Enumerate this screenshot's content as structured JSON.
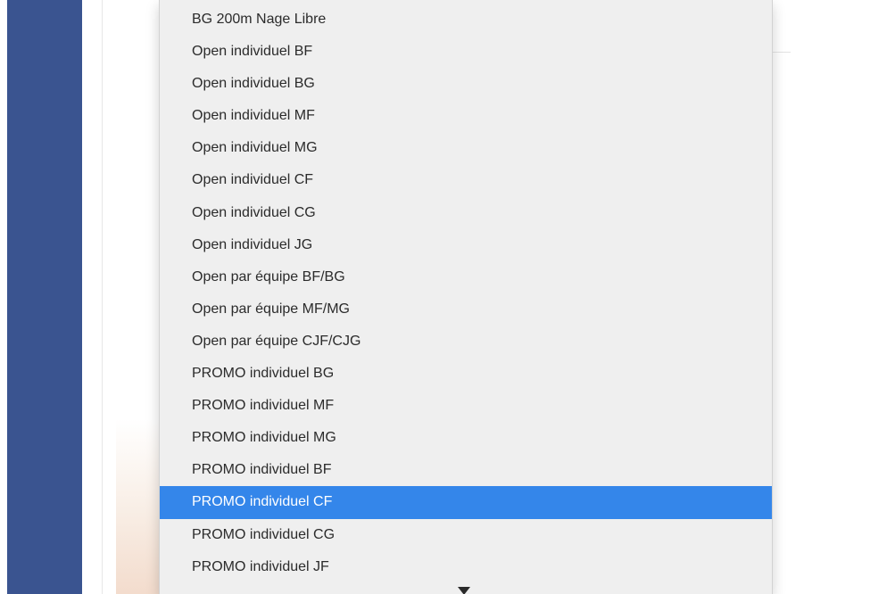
{
  "dropdown": {
    "selected_index": 15,
    "items": [
      {
        "label": "BG 200m Nage Libre"
      },
      {
        "label": "Open individuel BF"
      },
      {
        "label": "Open individuel BG"
      },
      {
        "label": "Open individuel MF"
      },
      {
        "label": "Open individuel MG"
      },
      {
        "label": "Open individuel CF"
      },
      {
        "label": "Open individuel CG"
      },
      {
        "label": "Open individuel JG"
      },
      {
        "label": "Open par équipe BF/BG"
      },
      {
        "label": "Open par équipe MF/MG"
      },
      {
        "label": "Open par équipe CJF/CJG"
      },
      {
        "label": "PROMO individuel BG"
      },
      {
        "label": "PROMO individuel MF"
      },
      {
        "label": "PROMO individuel MG"
      },
      {
        "label": "PROMO individuel BF"
      },
      {
        "label": "PROMO individuel CF"
      },
      {
        "label": "PROMO individuel CG"
      },
      {
        "label": "PROMO individuel JF"
      }
    ],
    "scroll_indicator_icon": "triangle-down-icon"
  },
  "colors": {
    "sidebar": "#3a5490",
    "selection": "#3486ea",
    "menu_background": "#efefef"
  }
}
